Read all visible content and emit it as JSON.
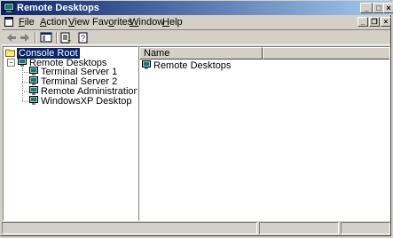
{
  "window": {
    "title": "Remote Desktops"
  },
  "menu": {
    "file": {
      "key": "F",
      "rest": "ile"
    },
    "action": {
      "key": "A",
      "rest": "ction"
    },
    "view": {
      "key": "V",
      "rest": "iew"
    },
    "favorites": {
      "pre": "Fav",
      "key": "o",
      "rest": "rites"
    },
    "window": {
      "key": "W",
      "rest": "indow"
    },
    "help": {
      "key": "H",
      "rest": "elp"
    }
  },
  "tree": {
    "root": "Console Root",
    "remote_desktops": "Remote Desktops",
    "items": [
      "Terminal Server 1",
      "Terminal Server 2",
      "Remote Administration Server",
      "WindowsXP Desktop"
    ]
  },
  "list": {
    "columns": [
      "Name"
    ],
    "rows": [
      "Remote Desktops"
    ]
  },
  "icons": {
    "app": "remote-desktops-icon",
    "back": "back-arrow-icon",
    "forward": "forward-arrow-icon",
    "show_hide_tree": "show-hide-tree-icon",
    "export_list": "export-list-icon",
    "help": "help-icon"
  },
  "colors": {
    "titlebar": "#0a246a",
    "selection": "#0a246a",
    "face": "#d4d0c8"
  }
}
